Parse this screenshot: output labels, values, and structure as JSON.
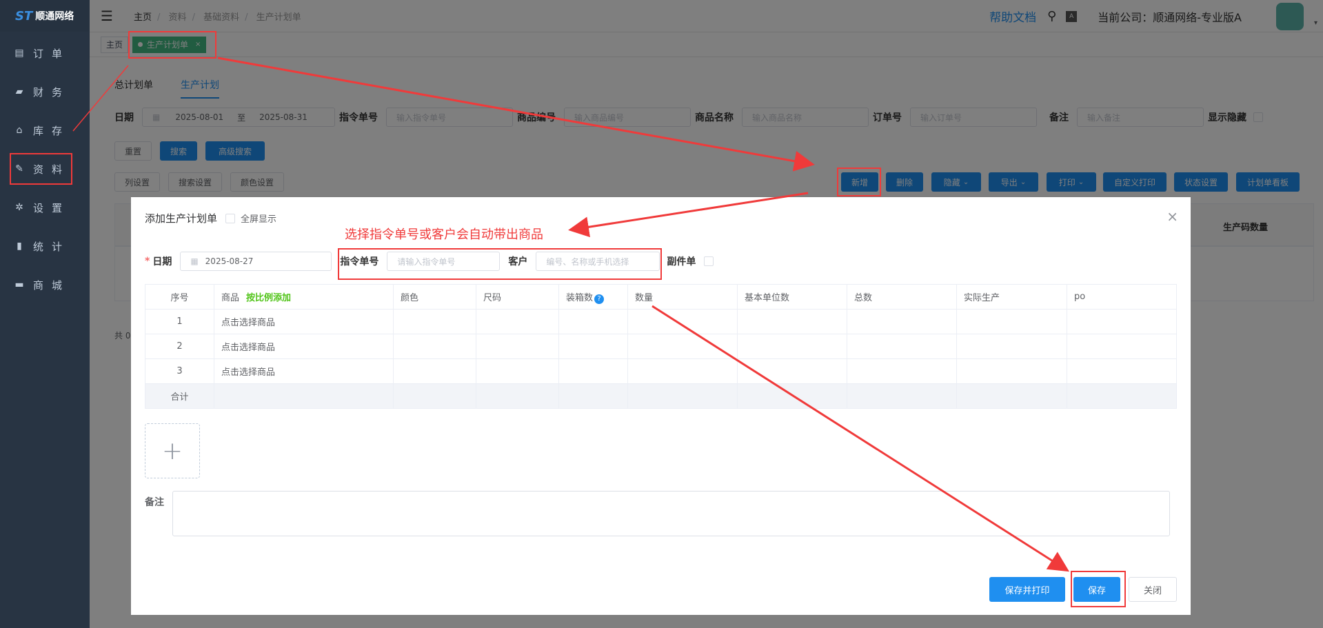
{
  "sidebar": {
    "logo": "顺通网络",
    "items": [
      {
        "label": "订单",
        "icon": "document-icon"
      },
      {
        "label": "财务",
        "icon": "wallet-icon"
      },
      {
        "label": "库存",
        "icon": "home-icon"
      },
      {
        "label": "资料",
        "icon": "edit-icon"
      },
      {
        "label": "设置",
        "icon": "gear-icon"
      },
      {
        "label": "统计",
        "icon": "bar-chart-icon"
      },
      {
        "label": "商城",
        "icon": "store-icon"
      }
    ]
  },
  "header": {
    "breadcrumb": [
      "主页",
      "资料",
      "基础资料",
      "生产计划单"
    ],
    "help": "帮助文档",
    "company": "当前公司：顺通网络-专业版A"
  },
  "tags": {
    "home": "主页",
    "active": "生产计划单"
  },
  "tabs": [
    "总计划单",
    "生产计划"
  ],
  "filter": {
    "date_label": "日期",
    "date_from": "2025-08-01",
    "date_to_sep": "至",
    "date_to": "2025-08-31",
    "order_label": "指令单号",
    "order_ph": "输入指令单号",
    "goods_code_label": "商品编号",
    "goods_code_ph": "输入商品编号",
    "goods_name_label": "商品名称",
    "goods_name_ph": "输入商品名称",
    "order_no_label": "订单号",
    "order_no_ph": "输入订单号",
    "remark_label": "备注",
    "remark_ph": "输入备注",
    "show_hidden": "显示隐藏"
  },
  "buttons": {
    "reset": "重置",
    "search": "搜索",
    "advanced": "高级搜索",
    "col_settings": "列设置",
    "search_settings": "搜索设置",
    "color_settings": "颜色设置",
    "add": "新增",
    "delete": "删除",
    "hide": "隐藏",
    "export": "导出",
    "print": "打印",
    "custom_print": "自定义打印",
    "status_settings": "状态设置",
    "board": "计划单看板"
  },
  "bg_table": {
    "col_last": "生产码数量",
    "total_prefix": "共 0"
  },
  "dialog": {
    "title": "添加生产计划单",
    "fullscreen": "全屏显示",
    "date_label": "日期",
    "date_value": "2025-08-27",
    "order_label": "指令单号",
    "order_ph": "请输入指令单号",
    "customer_label": "客户",
    "customer_ph": "编号、名称或手机选择",
    "copy_label": "副件单",
    "columns": [
      "序号",
      "商品",
      "颜色",
      "尺码",
      "装箱数",
      "数量",
      "基本单位数",
      "总数",
      "实际生产",
      "po"
    ],
    "add_ratio": "按比例添加",
    "rows": [
      {
        "no": "1",
        "goods": "点击选择商品"
      },
      {
        "no": "2",
        "goods": "点击选择商品"
      },
      {
        "no": "3",
        "goods": "点击选择商品"
      }
    ],
    "sum_label": "合计",
    "remark_label": "备注",
    "save_print": "保存并打印",
    "save": "保存",
    "close": "关闭"
  },
  "annotation": "选择指令单号或客户会自动带出商品",
  "colors": {
    "primary": "#1f8ff0",
    "annotation": "#f03a3a",
    "sidebar": "#283443",
    "tag_active": "#42b983"
  }
}
